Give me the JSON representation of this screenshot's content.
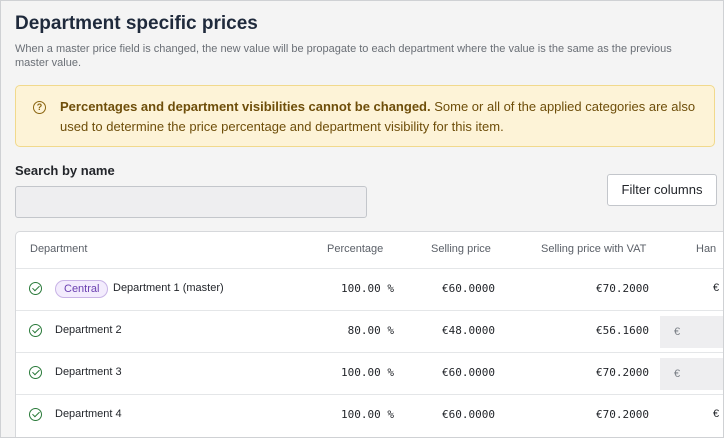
{
  "page": {
    "title": "Department specific prices",
    "subtitle": "When a master price field is changed, the new value will be propagate to each department where the value is the same as the previous master value."
  },
  "alert": {
    "bold": "Percentages and department visibilities cannot be changed.",
    "text": " Some or all of the applied categories are also used to determine the price percentage and department visibility for this item.",
    "icon": "question-circle-icon"
  },
  "search": {
    "label": "Search by name",
    "value": "",
    "placeholder": ""
  },
  "filter_button": "Filter columns",
  "table": {
    "headers": {
      "department": "Department",
      "percentage": "Percentage",
      "selling_price": "Selling price",
      "selling_price_vat": "Selling price with VAT",
      "truncated": "Han"
    },
    "rows": [
      {
        "badge": "Central",
        "name": "Department 1 (master)",
        "percentage": "100.00 %",
        "selling_price": "€60.0000",
        "selling_price_vat": "€70.2000",
        "extra": "€",
        "extra_is_input": false
      },
      {
        "badge": "",
        "name": "Department 2",
        "percentage": "80.00 %",
        "selling_price": "€48.0000",
        "selling_price_vat": "€56.1600",
        "extra": "€",
        "extra_is_input": true
      },
      {
        "badge": "",
        "name": "Department 3",
        "percentage": "100.00 %",
        "selling_price": "€60.0000",
        "selling_price_vat": "€70.2000",
        "extra": "€",
        "extra_is_input": true
      },
      {
        "badge": "",
        "name": "Department 4",
        "percentage": "100.00 %",
        "selling_price": "€60.0000",
        "selling_price_vat": "€70.2000",
        "extra": "€",
        "extra_is_input": false
      }
    ]
  },
  "colors": {
    "alert_bg": "#fdf3d7",
    "alert_text": "#6e4e0a",
    "check": "#2a7a3a",
    "badge": "#6a3fb0"
  }
}
